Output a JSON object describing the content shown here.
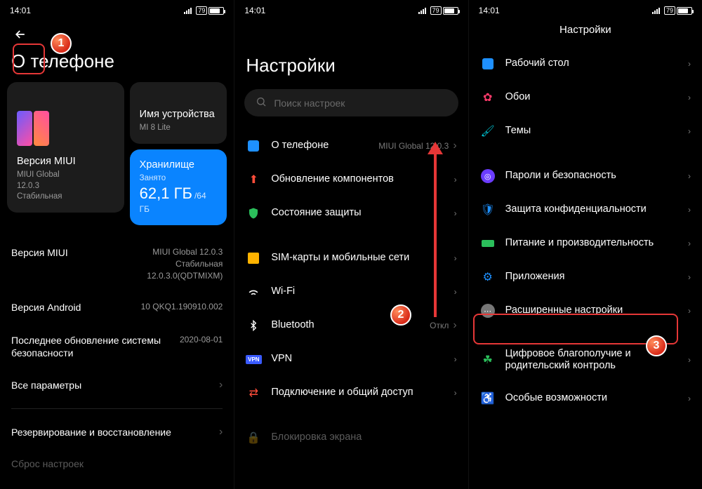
{
  "status": {
    "time": "14:01",
    "battery": "79"
  },
  "panel1": {
    "title": "О телефоне",
    "miui_card": {
      "title": "Версия MIUI",
      "line1": "MIUI Global",
      "line2": "12.0.3",
      "line3": "Стабильная"
    },
    "device_card": {
      "title": "Имя устройства",
      "value": "MI 8 Lite"
    },
    "storage_card": {
      "title": "Хранилище",
      "used_label": "Занято",
      "used": "62,1 ГБ",
      "of": "/64 ГБ"
    },
    "kv": {
      "miui_ver_k": "Версия MIUI",
      "miui_ver_v": "MIUI Global 12.0.3\nСтабильная\n12.0.3.0(QDTMIXM)",
      "android_k": "Версия Android",
      "android_v": "10 QKQ1.190910.002",
      "sec_k": "Последнее обновление системы безопасности",
      "sec_v": "2020-08-01",
      "all_params": "Все параметры",
      "backup": "Резервирование и восстановление",
      "reset": "Сброс настроек"
    }
  },
  "panel2": {
    "title": "Настройки",
    "search_placeholder": "Поиск настроек",
    "items": {
      "about": "О телефоне",
      "about_trail": "MIUI Global 12.0.3",
      "update": "Обновление компонентов",
      "protect": "Состояние защиты",
      "sim": "SIM-карты и мобильные сети",
      "wifi": "Wi-Fi",
      "bt": "Bluetooth",
      "bt_trail": "Откл",
      "vpn": "VPN",
      "conn": "Подключение и общий доступ",
      "lock": "Блокировка экрана"
    }
  },
  "panel3": {
    "title": "Настройки",
    "items": {
      "home": "Рабочий стол",
      "wall": "Обои",
      "themes": "Темы",
      "pass": "Пароли и безопасность",
      "privacy": "Защита конфиденциальности",
      "battery": "Питание и производительность",
      "apps": "Приложения",
      "adv": "Расширенные настройки",
      "wellbeing": "Цифровое благополучие и родительский контроль",
      "access": "Особые возможности"
    }
  },
  "badges": {
    "b1": "1",
    "b2": "2",
    "b3": "3"
  }
}
